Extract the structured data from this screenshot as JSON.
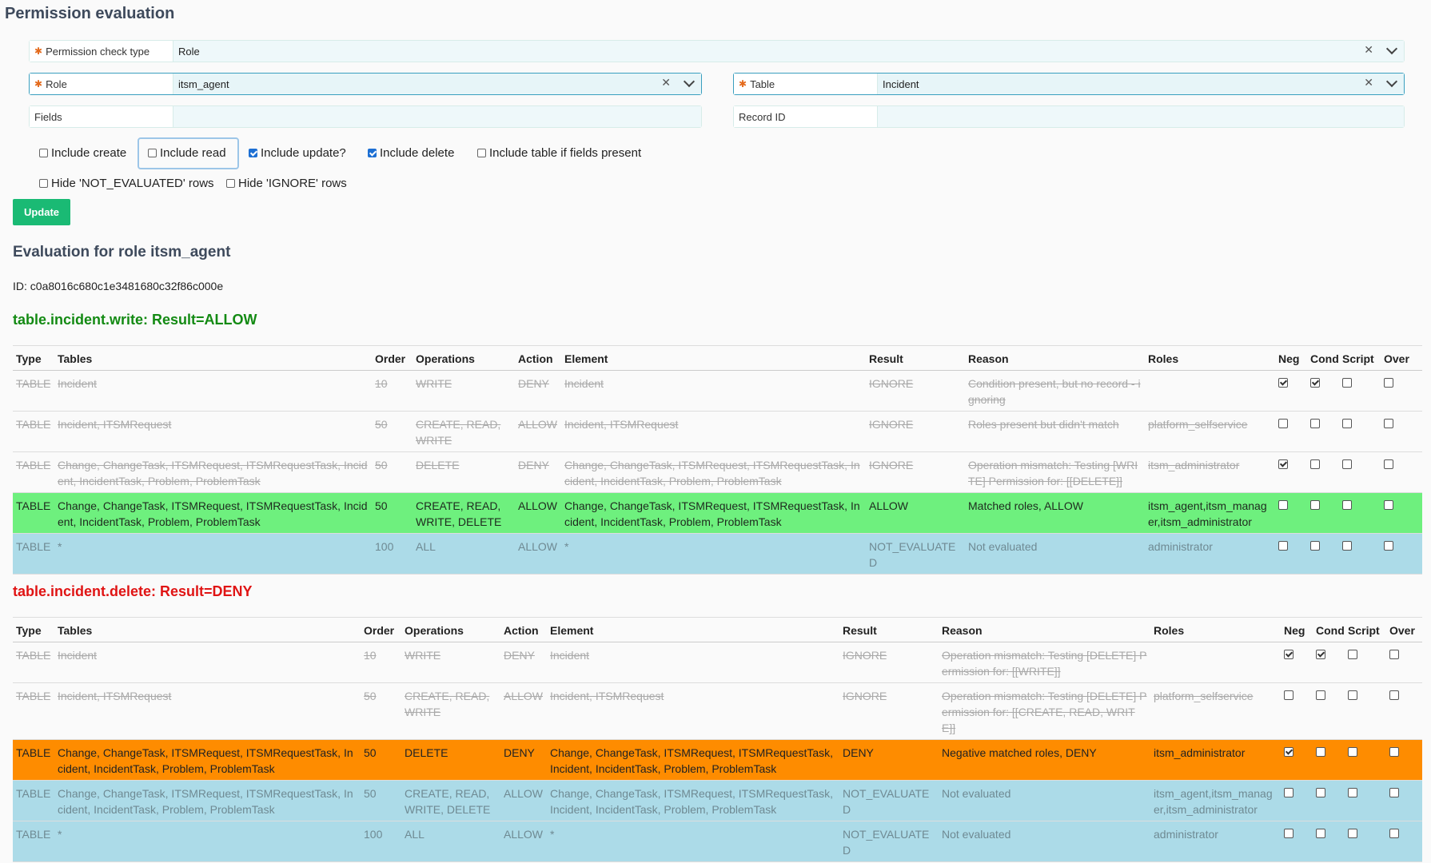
{
  "page_title": "Permission evaluation",
  "form": {
    "check_type": {
      "label": "Permission check type",
      "value": "Role"
    },
    "role": {
      "label": "Role",
      "value": "itsm_agent"
    },
    "table": {
      "label": "Table",
      "value": "Incident"
    },
    "fields": {
      "label": "Fields",
      "value": ""
    },
    "record_id": {
      "label": "Record ID",
      "value": ""
    }
  },
  "checkboxes": {
    "include_create": {
      "label": "Include create",
      "checked": false
    },
    "include_read": {
      "label": "Include read",
      "checked": false
    },
    "include_update": {
      "label": "Include update?",
      "checked": true
    },
    "include_delete": {
      "label": "Include delete",
      "checked": true
    },
    "include_table": {
      "label": "Include table if fields present",
      "checked": false
    },
    "hide_not_evaluated": {
      "label": "Hide 'NOT_EVALUATED' rows",
      "checked": false
    },
    "hide_ignore": {
      "label": "Hide 'IGNORE' rows",
      "checked": false
    }
  },
  "update_label": "Update",
  "evaluation_title": "Evaluation for role itsm_agent",
  "evaluation_id": "ID: c0a8016c680c1e3481680c32f86c000e",
  "columns": [
    "Type",
    "Tables",
    "Order",
    "Operations",
    "Action",
    "Element",
    "Result",
    "Reason",
    "Roles",
    "Neg",
    "Cond",
    "Script",
    "Over"
  ],
  "write_section": {
    "heading": "table.incident.write: Result=ALLOW",
    "rows": [
      {
        "status": "ignored",
        "type": "TABLE",
        "tables": "Incident",
        "order": "10",
        "operations": "WRITE",
        "action": "DENY",
        "element": "Incident",
        "result": "IGNORE",
        "reason": "Condition present, but no record - ignoring",
        "roles": "",
        "neg": true,
        "cond": true,
        "script": false,
        "over": false
      },
      {
        "status": "ignored",
        "type": "TABLE",
        "tables": "Incident, ITSMRequest",
        "order": "50",
        "operations": "CREATE, READ, WRITE",
        "action": "ALLOW",
        "element": "Incident, ITSMRequest",
        "result": "IGNORE",
        "reason": "Roles present but didn't match",
        "roles": "platform_selfservice",
        "neg": false,
        "cond": false,
        "script": false,
        "over": false
      },
      {
        "status": "ignored",
        "type": "TABLE",
        "tables": "Change, ChangeTask, ITSMRequest, ITSMRequestTask, Incident, IncidentTask, Problem, ProblemTask",
        "order": "50",
        "operations": "DELETE",
        "action": "DENY",
        "element": "Change, ChangeTask, ITSMRequest, ITSMRequestTask, Incident, IncidentTask, Problem, ProblemTask",
        "result": "IGNORE",
        "reason": "Operation mismatch: Testing [WRITE] Permission for: [[DELETE]]",
        "roles": "itsm_administrator",
        "neg": true,
        "cond": false,
        "script": false,
        "over": false
      },
      {
        "status": "allow",
        "type": "TABLE",
        "tables": "Change, ChangeTask, ITSMRequest, ITSMRequestTask, Incident, IncidentTask, Problem, ProblemTask",
        "order": "50",
        "operations": "CREATE, READ, WRITE, DELETE",
        "action": "ALLOW",
        "element": "Change, ChangeTask, ITSMRequest, ITSMRequestTask, Incident, IncidentTask, Problem, ProblemTask",
        "result": "ALLOW",
        "reason": "Matched roles, ALLOW",
        "roles": "itsm_agent,itsm_manager,itsm_administrator",
        "neg": false,
        "cond": false,
        "script": false,
        "over": false
      },
      {
        "status": "notevaluated",
        "type": "TABLE",
        "tables": "*",
        "order": "100",
        "operations": "ALL",
        "action": "ALLOW",
        "element": "*",
        "result": "NOT_EVALUATED",
        "reason": "Not evaluated",
        "roles": "administrator",
        "neg": false,
        "cond": false,
        "script": false,
        "over": false
      }
    ]
  },
  "delete_section": {
    "heading": "table.incident.delete: Result=DENY",
    "rows": [
      {
        "status": "ignored",
        "type": "TABLE",
        "tables": "Incident",
        "order": "10",
        "operations": "WRITE",
        "action": "DENY",
        "element": "Incident",
        "result": "IGNORE",
        "reason": "Operation mismatch: Testing [DELETE] Permission for: [[WRITE]]",
        "roles": "",
        "neg": true,
        "cond": true,
        "script": false,
        "over": false
      },
      {
        "status": "ignored",
        "type": "TABLE",
        "tables": "Incident, ITSMRequest",
        "order": "50",
        "operations": "CREATE, READ, WRITE",
        "action": "ALLOW",
        "element": "Incident, ITSMRequest",
        "result": "IGNORE",
        "reason": "Operation mismatch: Testing [DELETE] Permission for: [[CREATE, READ, WRITE]]",
        "roles": "platform_selfservice",
        "neg": false,
        "cond": false,
        "script": false,
        "over": false
      },
      {
        "status": "deny",
        "type": "TABLE",
        "tables": "Change, ChangeTask, ITSMRequest, ITSMRequestTask, Incident, IncidentTask, Problem, ProblemTask",
        "order": "50",
        "operations": "DELETE",
        "action": "DENY",
        "element": "Change, ChangeTask, ITSMRequest, ITSMRequestTask, Incident, IncidentTask, Problem, ProblemTask",
        "result": "DENY",
        "reason": "Negative matched roles, DENY",
        "roles": "itsm_administrator",
        "neg": true,
        "cond": false,
        "script": false,
        "over": false
      },
      {
        "status": "notevaluated",
        "type": "TABLE",
        "tables": "Change, ChangeTask, ITSMRequest, ITSMRequestTask, Incident, IncidentTask, Problem, ProblemTask",
        "order": "50",
        "operations": "CREATE, READ, WRITE, DELETE",
        "action": "ALLOW",
        "element": "Change, ChangeTask, ITSMRequest, ITSMRequestTask, Incident, IncidentTask, Problem, ProblemTask",
        "result": "NOT_EVALUATED",
        "reason": "Not evaluated",
        "roles": "itsm_agent,itsm_manager,itsm_administrator",
        "neg": false,
        "cond": false,
        "script": false,
        "over": false
      },
      {
        "status": "notevaluated",
        "type": "TABLE",
        "tables": "*",
        "order": "100",
        "operations": "ALL",
        "action": "ALLOW",
        "element": "*",
        "result": "NOT_EVALUATED",
        "reason": "Not evaluated",
        "roles": "administrator",
        "neg": false,
        "cond": false,
        "script": false,
        "over": false
      }
    ]
  }
}
